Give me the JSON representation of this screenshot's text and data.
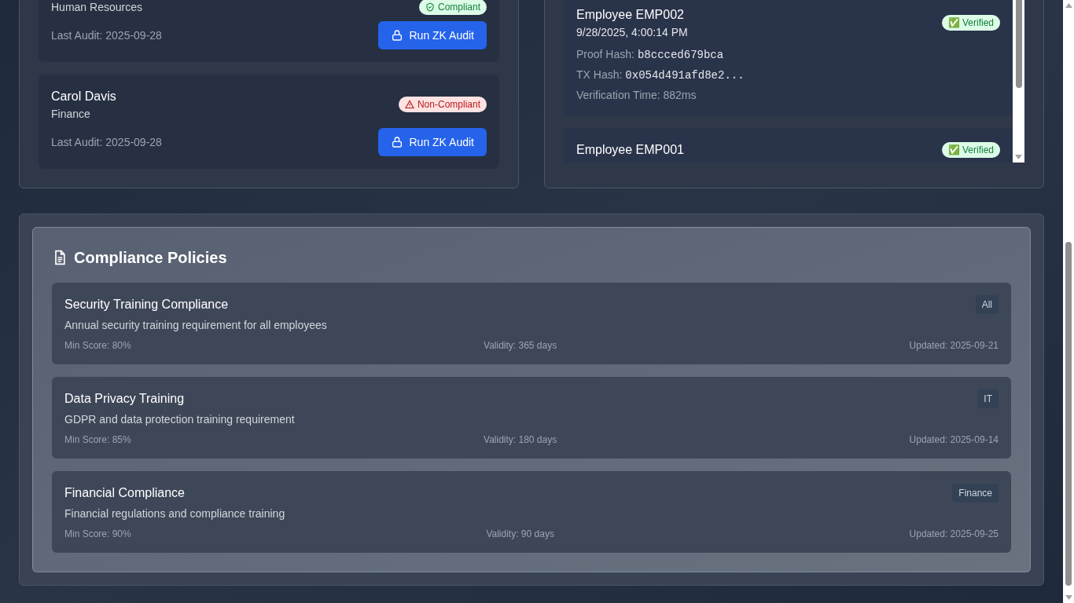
{
  "employees": [
    {
      "department": "Human Resources",
      "status": {
        "kind": "compliant",
        "label": "Compliant"
      },
      "last_audit": "Last Audit: 2025-09-28",
      "button": "Run ZK Audit"
    },
    {
      "name": "Carol Davis",
      "department": "Finance",
      "status": {
        "kind": "non_compliant",
        "label": "Non-Compliant"
      },
      "last_audit": "Last Audit: 2025-09-28",
      "button": "Run ZK Audit"
    }
  ],
  "verifications": [
    {
      "title": "Employee EMP002",
      "time": "9/28/2025, 4:00:14 PM",
      "status": "✅ Verified",
      "proof_label": "Proof Hash:",
      "proof_hash": "b8ccced679bca",
      "tx_label": "TX Hash:",
      "tx_hash": "0x054d491afd8e2...",
      "verification_time": "Verification Time: 882ms"
    },
    {
      "title": "Employee EMP001",
      "status": "✅ Verified"
    }
  ],
  "policies": {
    "title": "Compliance Policies",
    "items": [
      {
        "name": "Security Training Compliance",
        "description": "Annual security training requirement for all employees",
        "tag": "All",
        "min_score": "Min Score: 80%",
        "validity": "Validity: 365 days",
        "updated": "Updated: 2025-09-21"
      },
      {
        "name": "Data Privacy Training",
        "description": "GDPR and data protection training requirement",
        "tag": "IT",
        "min_score": "Min Score: 85%",
        "validity": "Validity: 180 days",
        "updated": "Updated: 2025-09-14"
      },
      {
        "name": "Financial Compliance",
        "description": "Financial regulations and compliance training",
        "tag": "Finance",
        "min_score": "Min Score: 90%",
        "validity": "Validity: 90 days",
        "updated": "Updated: 2025-09-25"
      }
    ]
  }
}
